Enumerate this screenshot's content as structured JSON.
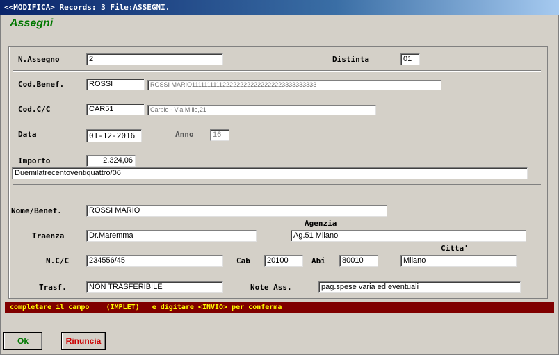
{
  "window": {
    "title": "<<MODIFICA> Records: 3 File:ASSEGNI."
  },
  "form": {
    "heading": "Assegni",
    "n_assegno": {
      "label": "N.Assegno",
      "value": "2"
    },
    "distinta": {
      "label": "Distinta",
      "value": "01"
    },
    "cod_benef": {
      "label": "Cod.Benef.",
      "value": "ROSSI",
      "description": "ROSSI MARIO1111111111222222222222222223333333333"
    },
    "cod_cc": {
      "label": "Cod.C/C",
      "value": "CAR51",
      "description": "Carpio - Via Mille,21"
    },
    "data": {
      "label": "Data",
      "value": "01-12-2016"
    },
    "anno": {
      "label": "Anno",
      "value": "16"
    },
    "importo": {
      "label": "Importo",
      "value": "2.324,06",
      "in_words": "Duemilatrecentoventiquattro/06"
    },
    "nome_benef": {
      "label": "Nome/Benef.",
      "value": "ROSSI MARIO"
    },
    "traenza": {
      "label": "Traenza",
      "value": "Dr.Maremma"
    },
    "agenzia": {
      "label": "Agenzia",
      "value": "Ag.51 Milano"
    },
    "ncc": {
      "label": "N.C/C",
      "value": "234556/45"
    },
    "cab": {
      "label": "Cab",
      "value": "20100"
    },
    "abi": {
      "label": "Abi",
      "value": "80010"
    },
    "citta": {
      "label": "Citta'",
      "value": "Milano"
    },
    "trasf": {
      "label": "Trasf.",
      "value": "NON TRASFERIBILE"
    },
    "note_ass": {
      "label": "Note Ass.",
      "value": "pag.spese varia ed eventuali"
    }
  },
  "status": {
    "message": "completare il campo    (IMPLET)   e digitare <INVIO> per conferma"
  },
  "buttons": {
    "ok": "Ok",
    "cancel": "Rinuncia"
  },
  "colors": {
    "heading": "#007800",
    "status_bg": "#800000",
    "status_fg": "#ffff00",
    "cancel_text": "#cc0000",
    "ok_text": "#007800"
  }
}
